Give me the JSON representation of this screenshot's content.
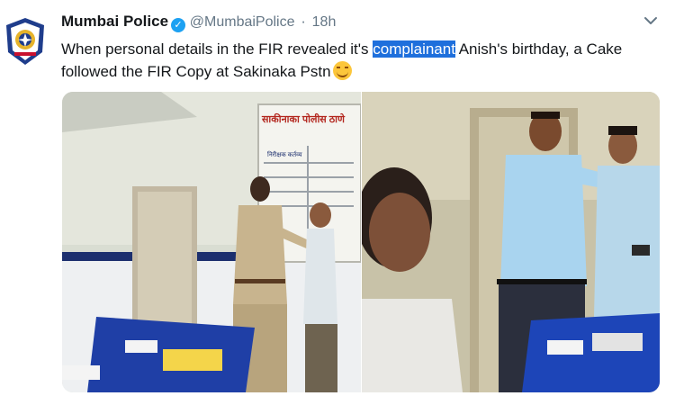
{
  "tweet": {
    "display_name": "Mumbai Police",
    "handle": "@MumbaiPolice",
    "separator": "·",
    "time": "18h",
    "text_before": "When personal details in the FIR revealed it's ",
    "text_highlight": "complainant",
    "text_after": " Anish's birthday, a Cake  followed the FIR Copy at Sakinaka Pstn"
  },
  "photo_left": {
    "sign_text": "साकीनाका पोलीस ठाणे",
    "board_text": "निरीक्षक कर्तव्य"
  },
  "icons": {
    "avatar": "mumbai-police-crest",
    "verified": "verified-badge-icon",
    "menu": "chevron-down-icon",
    "emoji": "smiling-face-emoji"
  },
  "colors": {
    "highlight": "#1e6fdc",
    "verified": "#1da1f2",
    "secondary_text": "#657786"
  }
}
